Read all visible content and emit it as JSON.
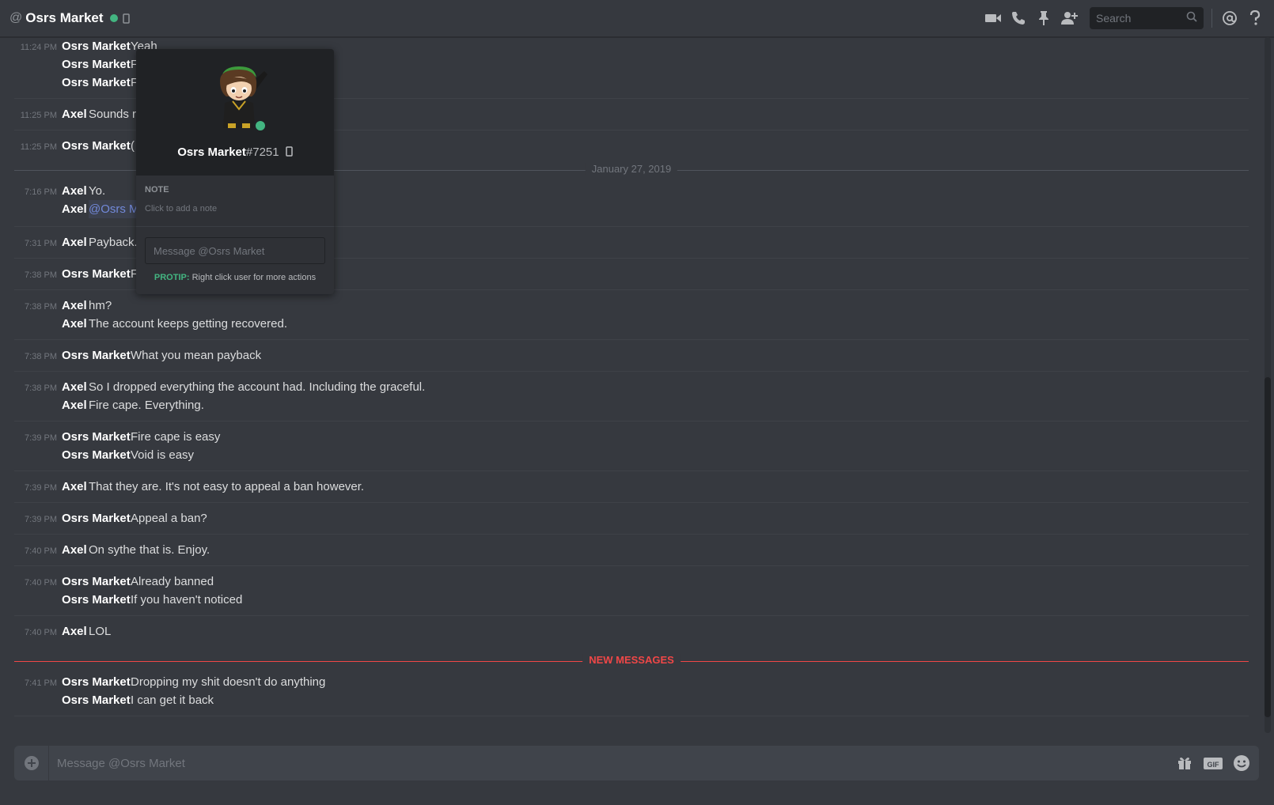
{
  "header": {
    "at_symbol": "@",
    "title": "Osrs Market",
    "search_placeholder": "Search",
    "status_color": "#43b581",
    "icons": [
      "mobile-icon",
      "video-icon",
      "phone-icon",
      "pin-icon",
      "add-friend-icon",
      "search-icon",
      "mention-icon",
      "help-icon"
    ]
  },
  "messages": [
    {
      "time": "11:24 PM",
      "lines": [
        {
          "author": "Osrs Market",
          "text": "Yeah"
        },
        {
          "author": "Osrs Market",
          "text": "F"
        },
        {
          "author": "Osrs Market",
          "text": "F"
        }
      ]
    },
    {
      "time": "11:25 PM",
      "lines": [
        {
          "author": "Axel",
          "text": "Sounds ri"
        }
      ]
    },
    {
      "time": "11:25 PM",
      "lines": [
        {
          "author": "Osrs Market",
          "text": "("
        }
      ]
    },
    {
      "time": "7:16 PM",
      "lines": [
        {
          "author": "Axel",
          "text": "Yo."
        },
        {
          "author": "Axel",
          "text": "",
          "mention": "@Osrs M"
        }
      ]
    },
    {
      "time": "7:31 PM",
      "lines": [
        {
          "author": "Axel",
          "text": "Payback."
        }
      ]
    },
    {
      "time": "7:38 PM",
      "lines": [
        {
          "author": "Osrs Market",
          "text": "F"
        }
      ]
    },
    {
      "time": "7:38 PM",
      "lines": [
        {
          "author": "Axel",
          "text": "hm?"
        },
        {
          "author": "Axel",
          "text": "The account keeps getting recovered."
        }
      ]
    },
    {
      "time": "7:38 PM",
      "lines": [
        {
          "author": "Osrs Market",
          "text": "What you mean payback"
        }
      ]
    },
    {
      "time": "7:38 PM",
      "lines": [
        {
          "author": "Axel",
          "text": "So I dropped everything the account had. Including the graceful."
        },
        {
          "author": "Axel",
          "text": "Fire cape. Everything."
        }
      ]
    },
    {
      "time": "7:39 PM",
      "lines": [
        {
          "author": "Osrs Market",
          "text": "Fire cape is easy"
        },
        {
          "author": "Osrs Market",
          "text": "Void is easy"
        }
      ]
    },
    {
      "time": "7:39 PM",
      "lines": [
        {
          "author": "Axel",
          "text": "That they are. It's not easy to appeal a ban however."
        }
      ]
    },
    {
      "time": "7:39 PM",
      "lines": [
        {
          "author": "Osrs Market",
          "text": "Appeal a ban?"
        }
      ]
    },
    {
      "time": "7:40 PM",
      "lines": [
        {
          "author": "Axel",
          "text": "On sythe that is. Enjoy."
        }
      ]
    },
    {
      "time": "7:40 PM",
      "lines": [
        {
          "author": "Osrs Market",
          "text": "Already banned"
        },
        {
          "author": "Osrs Market",
          "text": "If you haven't noticed"
        }
      ]
    },
    {
      "time": "7:40 PM",
      "lines": [
        {
          "author": "Axel",
          "text": "LOL"
        }
      ]
    },
    {
      "time": "7:41 PM",
      "lines": [
        {
          "author": "Osrs Market",
          "text": "Dropping my shit doesn't do anything"
        },
        {
          "author": "Osrs Market",
          "text": "I can get it back"
        }
      ]
    }
  ],
  "date_divider": "January 27, 2019",
  "new_messages_label": "NEW MESSAGES",
  "new_messages_color": "#f04747",
  "composer": {
    "placeholder": "Message @Osrs Market"
  },
  "popout": {
    "name": "Osrs Market",
    "discriminator": "#7251",
    "note_label": "NOTE",
    "note_placeholder": "Click to add a note",
    "message_placeholder": "Message @Osrs Market",
    "protip_key": "PROTIP:",
    "protip_text": " Right click user for more actions"
  }
}
